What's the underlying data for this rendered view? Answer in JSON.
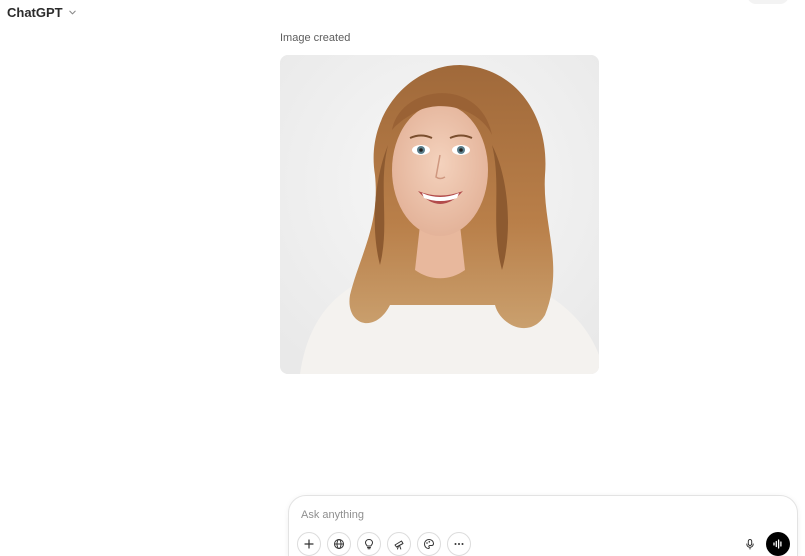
{
  "header": {
    "model_label": "ChatGPT",
    "chevron_icon": "chevron-down-icon"
  },
  "message": {
    "caption": "Image created",
    "image_icon": "generated-portrait-image"
  },
  "composer": {
    "placeholder": "Ask anything",
    "value": "",
    "tools": [
      {
        "name": "add",
        "icon": "plus-icon"
      },
      {
        "name": "search",
        "icon": "globe-icon"
      },
      {
        "name": "reason",
        "icon": "lightbulb-icon"
      },
      {
        "name": "deep-research",
        "icon": "telescope-icon"
      },
      {
        "name": "create-image",
        "icon": "palette-icon"
      },
      {
        "name": "more",
        "icon": "more-horizontal-icon"
      }
    ],
    "mic_icon": "microphone-icon",
    "voice_icon": "voice-mode-icon"
  },
  "colors": {
    "background": "#ffffff",
    "voice_button": "#000000",
    "caption": "#5d5d5d"
  }
}
